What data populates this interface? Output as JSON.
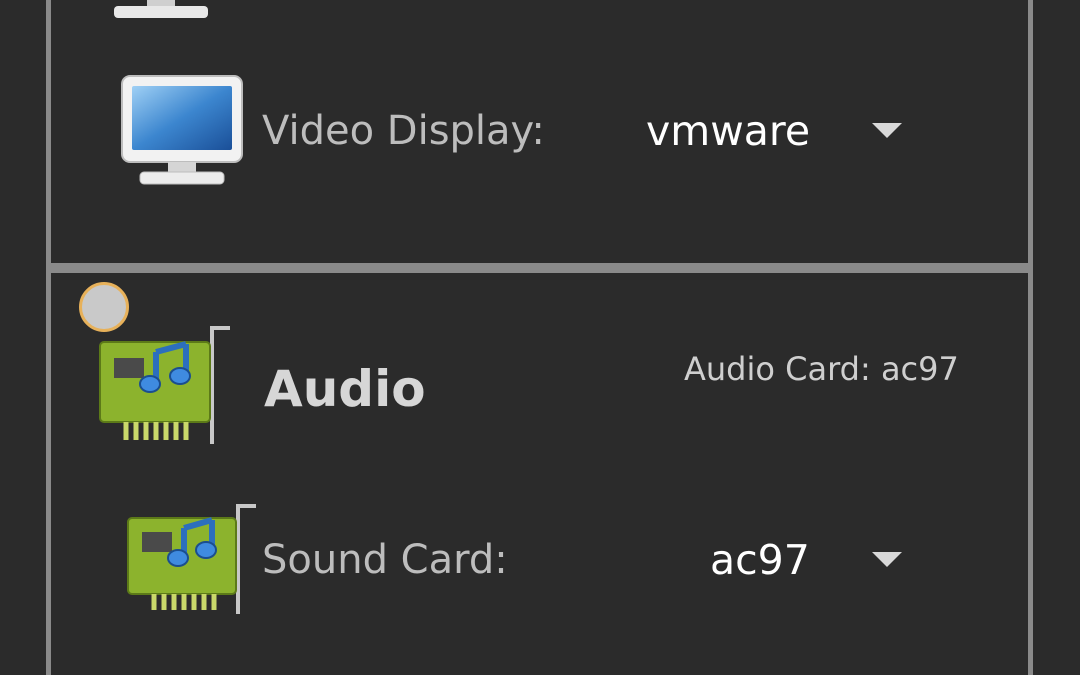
{
  "display_section": {
    "video_display": {
      "label": "Video Display:",
      "value": "vmware",
      "icon": "monitor-icon"
    }
  },
  "audio_section": {
    "title": "Audio",
    "summary": "Audio Card: ac97",
    "icon": "sound-card-icon",
    "sound_card": {
      "label": "Sound Card:",
      "value": "ac97",
      "icon": "sound-card-icon"
    }
  },
  "colors": {
    "background": "#2b2b2b",
    "frame": "#8a8a8a",
    "label": "#bdbdbd",
    "value": "#ffffff"
  }
}
